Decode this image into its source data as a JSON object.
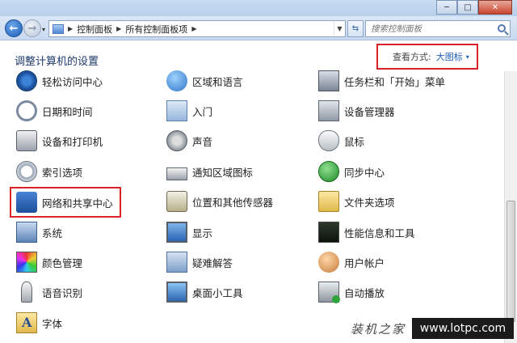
{
  "window": {
    "controls": {
      "minimize": "─",
      "maximize": "□",
      "close": "✕"
    }
  },
  "toolbar": {
    "back": "←",
    "forward": "→",
    "dropdown": "▾",
    "breadcrumbs": [
      "控制面板",
      "所有控制面板项"
    ],
    "refresh": "⇆",
    "search_placeholder": "搜索控制面板"
  },
  "header": {
    "title": "调整计算机的设置",
    "view_by_label": "查看方式:",
    "view_by_value": "大图标",
    "view_by_caret": "▾"
  },
  "items": [
    {
      "label": "轻松访问中心",
      "icon": "ease-of-access-icon"
    },
    {
      "label": "区域和语言",
      "icon": "globe-icon"
    },
    {
      "label": "任务栏和「开始」菜单",
      "icon": "taskbar-icon"
    },
    {
      "label": "日期和时间",
      "icon": "clock-icon"
    },
    {
      "label": "入门",
      "icon": "getting-started-icon"
    },
    {
      "label": "设备管理器",
      "icon": "device-manager-icon"
    },
    {
      "label": "设备和打印机",
      "icon": "printer-icon"
    },
    {
      "label": "声音",
      "icon": "speaker-icon"
    },
    {
      "label": "鼠标",
      "icon": "mouse-icon"
    },
    {
      "label": "索引选项",
      "icon": "indexing-icon"
    },
    {
      "label": "通知区域图标",
      "icon": "notification-tray-icon"
    },
    {
      "label": "同步中心",
      "icon": "sync-icon"
    },
    {
      "label": "网络和共享中心",
      "icon": "network-icon"
    },
    {
      "label": "位置和其他传感器",
      "icon": "location-sensor-icon"
    },
    {
      "label": "文件夹选项",
      "icon": "folder-icon"
    },
    {
      "label": "系统",
      "icon": "system-icon"
    },
    {
      "label": "显示",
      "icon": "display-icon"
    },
    {
      "label": "性能信息和工具",
      "icon": "performance-icon"
    },
    {
      "label": "颜色管理",
      "icon": "color-management-icon"
    },
    {
      "label": "疑难解答",
      "icon": "troubleshooting-icon"
    },
    {
      "label": "用户帐户",
      "icon": "user-accounts-icon"
    },
    {
      "label": "语音识别",
      "icon": "microphone-icon"
    },
    {
      "label": "桌面小工具",
      "icon": "gadgets-icon"
    },
    {
      "label": "自动播放",
      "icon": "autoplay-icon"
    },
    {
      "label": "字体",
      "icon": "fonts-icon"
    }
  ],
  "watermark": {
    "left_text": "装机之家",
    "right_text": "www.lotpc.com"
  },
  "colors": {
    "highlight_border": "#d8232a",
    "link_blue": "#1f5fb8",
    "title_blue": "#1e3a6b"
  }
}
